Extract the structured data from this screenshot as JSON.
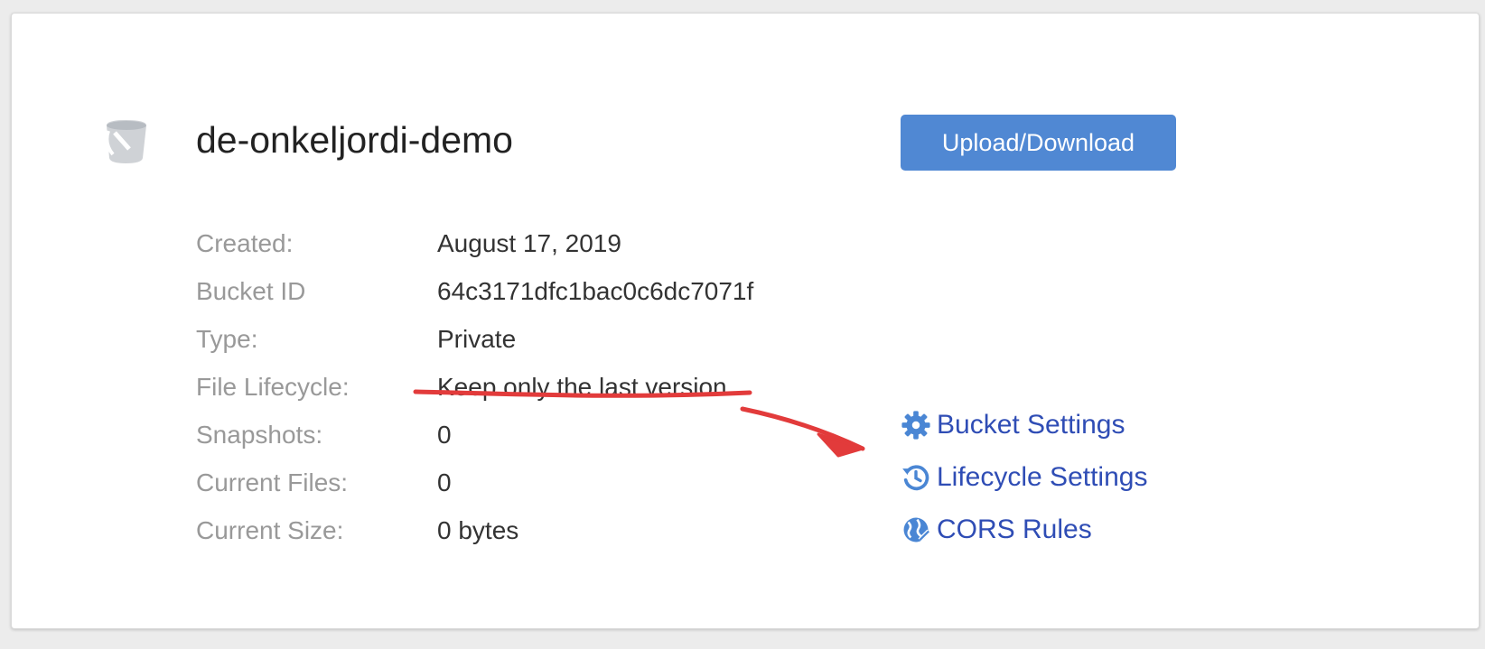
{
  "bucket": {
    "name": "de-onkeljordi-demo",
    "upload_label": "Upload/Download"
  },
  "details": [
    {
      "label": "Created:",
      "value": "August 17, 2019"
    },
    {
      "label": "Bucket ID",
      "value": "64c3171dfc1bac0c6dc7071f"
    },
    {
      "label": "Type:",
      "value": "Private"
    },
    {
      "label": "File Lifecycle:",
      "value": "Keep only the last version"
    },
    {
      "label": "Snapshots:",
      "value": "0"
    },
    {
      "label": "Current Files:",
      "value": "0"
    },
    {
      "label": "Current Size:",
      "value": "0 bytes"
    }
  ],
  "links": [
    {
      "label": "Bucket Settings",
      "icon": "gear-icon"
    },
    {
      "label": "Lifecycle Settings",
      "icon": "history-icon"
    },
    {
      "label": "CORS Rules",
      "icon": "globe-icon"
    }
  ],
  "colors": {
    "button": "#5088d3",
    "link": "#2f4db5",
    "icon": "#4a86d4",
    "annotation": "#e23b3b"
  }
}
